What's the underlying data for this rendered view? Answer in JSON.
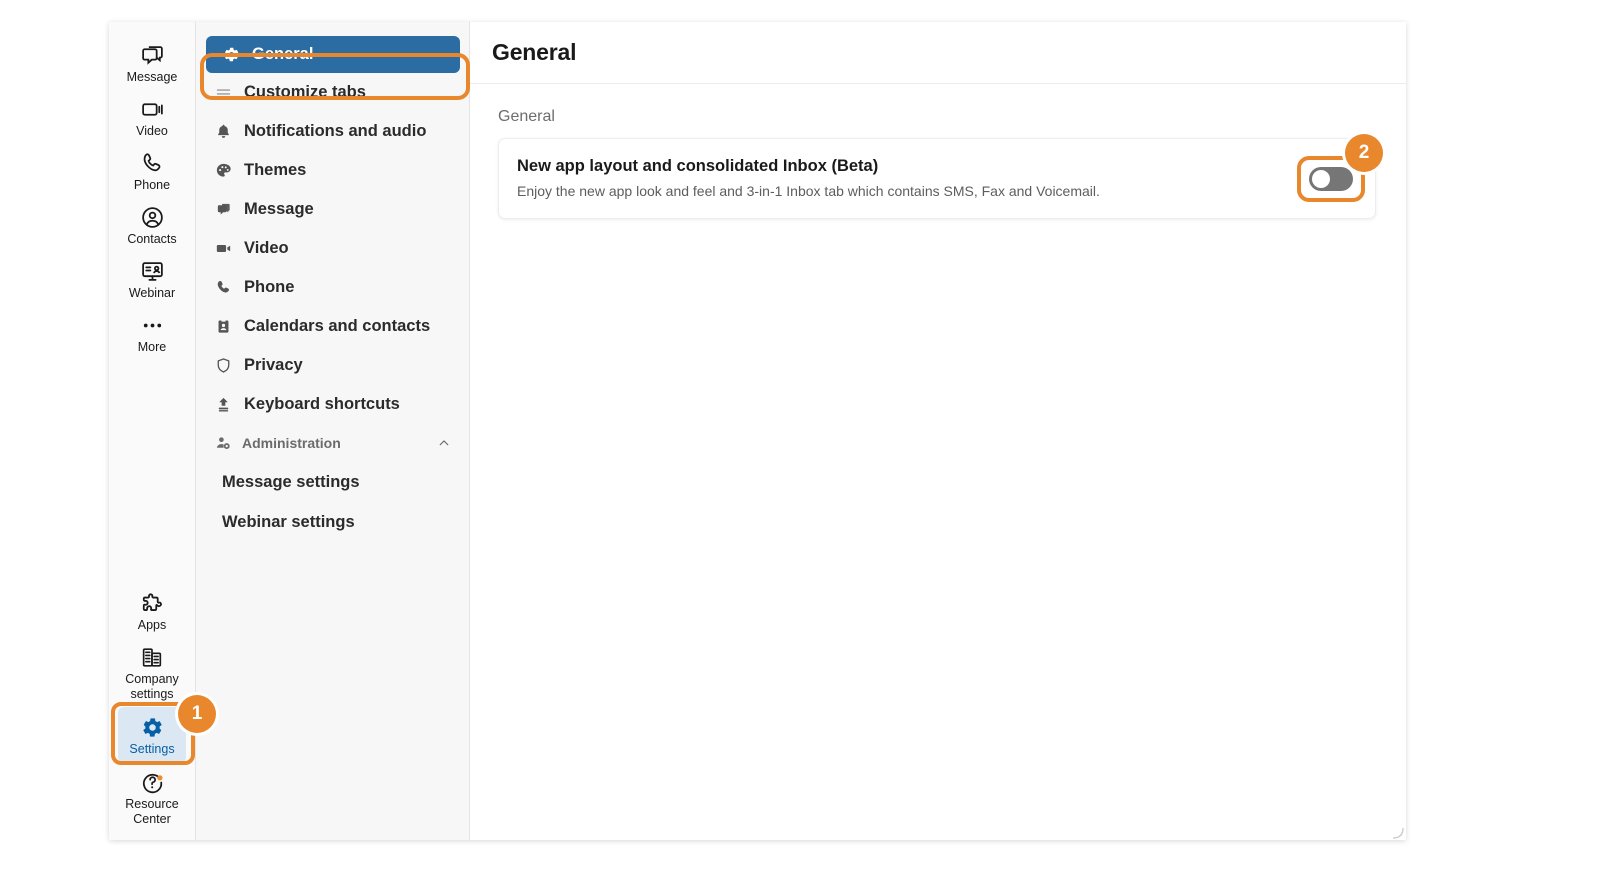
{
  "app": {
    "rail_top": [
      {
        "label": "Message",
        "icon": "message-icon"
      },
      {
        "label": "Video",
        "icon": "video-icon"
      },
      {
        "label": "Phone",
        "icon": "phone-icon"
      },
      {
        "label": "Contacts",
        "icon": "contacts-icon"
      },
      {
        "label": "Webinar",
        "icon": "webinar-icon"
      },
      {
        "label": "More",
        "icon": "more-icon"
      }
    ],
    "rail_bottom": [
      {
        "label": "Apps",
        "icon": "apps-icon"
      },
      {
        "label": "Company settings",
        "icon": "company-settings-icon"
      },
      {
        "label": "Settings",
        "icon": "gear-icon"
      },
      {
        "label": "Resource Center",
        "icon": "help-icon"
      }
    ]
  },
  "nav": {
    "items": [
      {
        "label": "General",
        "icon": "gear-icon",
        "selected": true
      },
      {
        "label": "Customize tabs",
        "icon": "customize-tabs-icon",
        "selected": false
      },
      {
        "label": "Notifications and audio",
        "icon": "bell-icon",
        "selected": false
      },
      {
        "label": "Themes",
        "icon": "palette-icon",
        "selected": false
      },
      {
        "label": "Message",
        "icon": "message-icon",
        "selected": false
      },
      {
        "label": "Video",
        "icon": "video-icon",
        "selected": false
      },
      {
        "label": "Phone",
        "icon": "phone-icon",
        "selected": false
      },
      {
        "label": "Calendars and contacts",
        "icon": "calendar-icon",
        "selected": false
      },
      {
        "label": "Privacy",
        "icon": "shield-icon",
        "selected": false
      },
      {
        "label": "Keyboard shortcuts",
        "icon": "keyboard-icon",
        "selected": false
      }
    ],
    "group": {
      "label": "Administration",
      "icon": "admin-user-icon",
      "expanded": true
    },
    "sub_items": [
      {
        "label": "Message settings"
      },
      {
        "label": "Webinar settings"
      }
    ]
  },
  "main": {
    "title": "General",
    "section_label": "General",
    "setting": {
      "title": "New app layout and consolidated Inbox (Beta)",
      "description": "Enjoy the new app look and feel and 3-in-1 Inbox tab which contains SMS, Fax and Voicemail.",
      "toggle_state": "off"
    }
  },
  "annotations": {
    "step1": "1",
    "step2": "2",
    "highlight_color": "#e8872b"
  }
}
